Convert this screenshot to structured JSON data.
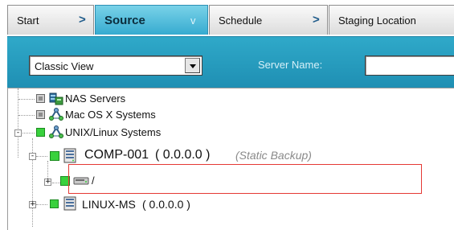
{
  "tabs": [
    {
      "label": "Start",
      "chevron": ">"
    },
    {
      "label": "Source",
      "chevron": "v"
    },
    {
      "label": "Schedule",
      "chevron": ">"
    },
    {
      "label": "Staging Location",
      "chevron": ""
    }
  ],
  "toolbar": {
    "view_select_value": "Classic View",
    "server_name_label": "Server Name:",
    "server_name_value": ""
  },
  "tree": {
    "nodes": [
      {
        "label": "NAS Servers",
        "icon": "nas-servers-icon",
        "checkbox": "partial"
      },
      {
        "label": "Mac OS X Systems",
        "icon": "network-group-icon",
        "checkbox": "partial"
      },
      {
        "label": "UNIX/Linux Systems",
        "icon": "network-group-icon",
        "checkbox": "partial-green",
        "expander": "-"
      },
      {
        "label": "COMP-001",
        "address": "( 0.0.0.0 )",
        "tag": "(Static Backup)",
        "icon": "server-icon",
        "checkbox": "checked",
        "expander": "-"
      },
      {
        "label": "/",
        "icon": "disk-drive-icon",
        "checkbox": "checked",
        "expander": "+"
      },
      {
        "label": "LINUX-MS",
        "address": "( 0.0.0.0 )",
        "icon": "server-icon",
        "checkbox": "partial-green",
        "expander": "+"
      }
    ]
  },
  "colors": {
    "toolbar": "#2fa9c9",
    "active_tab": "#4ab9da",
    "highlight_box": "#e53935",
    "checked": "#39d13d"
  }
}
